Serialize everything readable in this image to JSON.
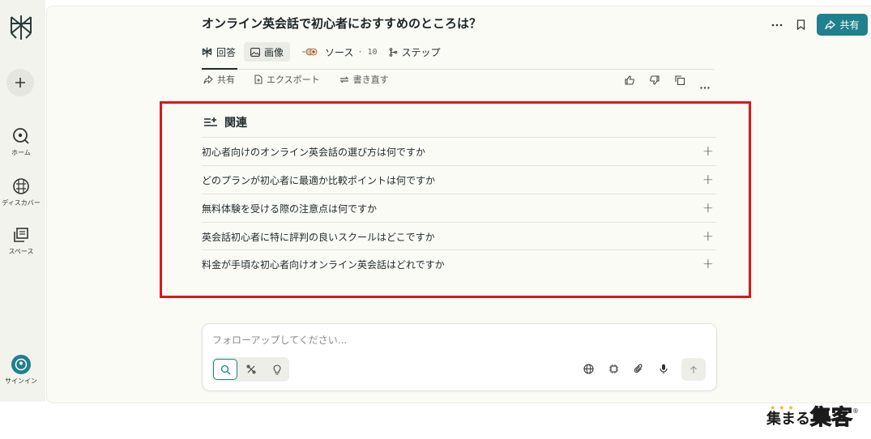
{
  "sidebar": {
    "nav": [
      {
        "label": "ホーム",
        "icon": "home-icon"
      },
      {
        "label": "ディスカバー",
        "icon": "discover-icon"
      },
      {
        "label": "スペース",
        "icon": "spaces-icon"
      }
    ],
    "signin": "サインイン"
  },
  "header": {
    "title": "オンライン英会話で初心者におすすめのところは？",
    "share": "共有"
  },
  "tabs": {
    "answer": "回答",
    "images": "画像",
    "sources": "ソース",
    "sources_count": "· 10",
    "steps": "ステップ"
  },
  "actions": {
    "share": "共有",
    "export": "エクスポート",
    "rewrite": "書き直す"
  },
  "related": {
    "heading": "関連",
    "items": [
      "初心者向けのオンライン英会話の選び方は何ですか",
      "どのプランが初心者に最適か比較ポイントは何ですか",
      "無料体験を受ける際の注意点は何ですか",
      "英会話初心者に特に評判の良いスクールはどこですか",
      "料金が手頃な初心者向けオンライン英会話はどれですか"
    ]
  },
  "composer": {
    "placeholder": "フォローアップしてください..."
  },
  "watermark": {
    "text_a": "集まる",
    "text_b": "集客",
    "reg": "®"
  },
  "colors": {
    "accent": "#20808d",
    "highlight_box": "#e0151a",
    "background": "#fbfbf6"
  }
}
